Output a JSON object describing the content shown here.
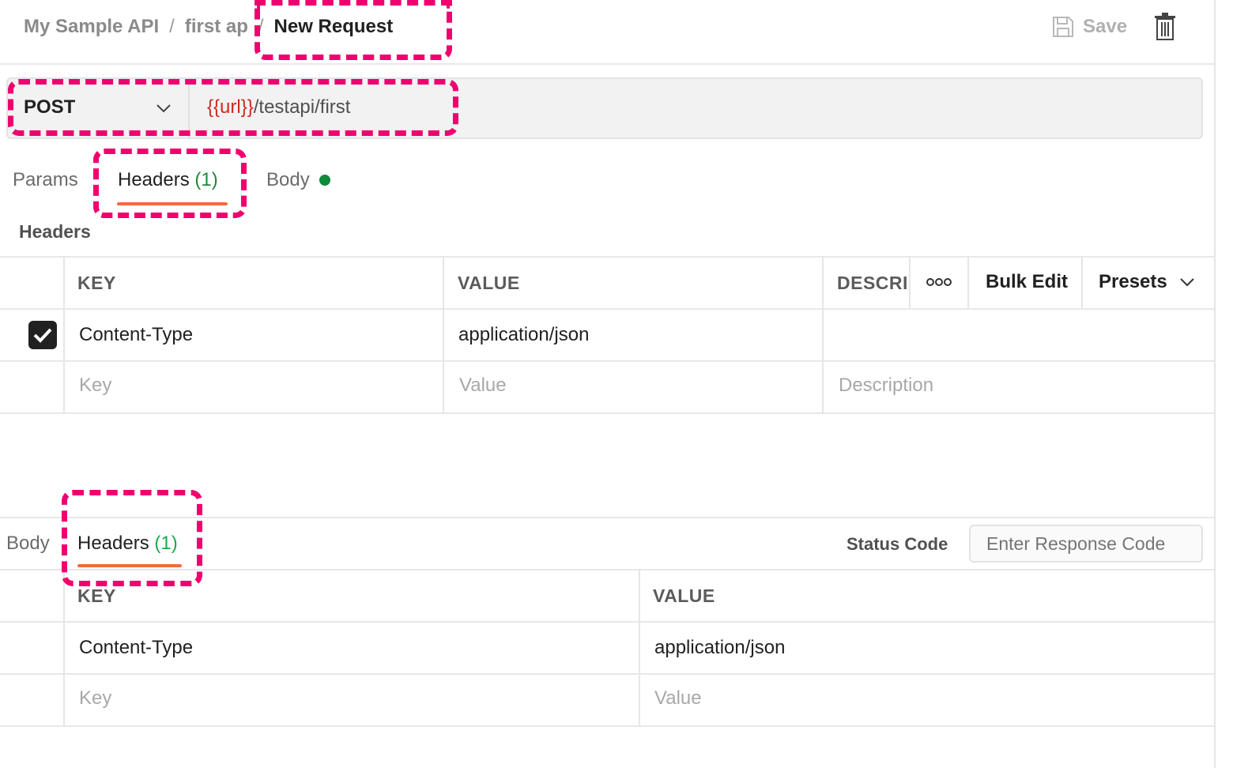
{
  "breadcrumb": {
    "collection": "My Sample API",
    "folder": "first ap",
    "request": "New Request"
  },
  "header": {
    "save_label": "Save"
  },
  "request": {
    "method": "POST",
    "url_variable": "{{url}}",
    "url_path": "/testapi/first"
  },
  "request_tabs": {
    "params": "Params",
    "headers": "Headers",
    "headers_count": "(1)",
    "body": "Body"
  },
  "headers_section": {
    "title": "Headers",
    "columns": {
      "key": "KEY",
      "value": "VALUE",
      "description": "DESCRI"
    },
    "bulk_edit": "Bulk Edit",
    "presets": "Presets",
    "rows": [
      {
        "key": "Content-Type",
        "value": "application/json",
        "description": "",
        "checked": true
      }
    ],
    "placeholders": {
      "key": "Key",
      "value": "Value",
      "description": "Description"
    }
  },
  "response_tabs": {
    "body": "Body",
    "headers": "Headers",
    "headers_count": "(1)"
  },
  "status": {
    "label": "Status Code",
    "placeholder": "Enter Response Code"
  },
  "response_headers": {
    "columns": {
      "key": "KEY",
      "value": "VALUE"
    },
    "rows": [
      {
        "key": "Content-Type",
        "value": "application/json"
      }
    ],
    "placeholders": {
      "key": "Key",
      "value": "Value"
    }
  },
  "colors": {
    "accent": "#f26b3a",
    "highlight": "#f0006e",
    "variable": "#d12a1e",
    "count": "#1f8a3a",
    "body_dot": "#0f8a3a"
  }
}
